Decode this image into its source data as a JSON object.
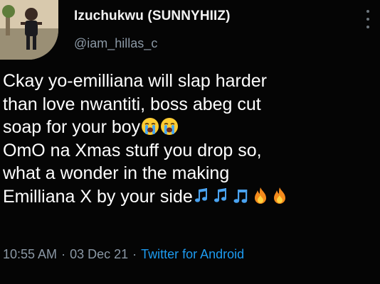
{
  "author": {
    "display_name": "Izuchukwu (SUNNYHIIZ)",
    "handle": "@iam_hillas_c"
  },
  "tweet": {
    "lines": [
      {
        "text": "Ckay yo-emilliana will slap harder",
        "emojis": []
      },
      {
        "text": "than love nwantiti, boss abeg cut",
        "emojis": []
      },
      {
        "text": "soap for your boy",
        "emojis": [
          "loudly-crying-face",
          "loudly-crying-face"
        ]
      },
      {
        "text": "OmO na Xmas stuff you drop so,",
        "emojis": []
      },
      {
        "text": "what a wonder in the making",
        "emojis": []
      },
      {
        "text": "Emilliana X by your side",
        "emojis": [
          "multiple-musical-notes",
          "multiple-musical-notes",
          "musical-note",
          "fire",
          "fire"
        ]
      }
    ]
  },
  "meta": {
    "time": "10:55 AM",
    "date": "03 Dec 21",
    "separator": "·",
    "source": "Twitter for Android"
  },
  "colors": {
    "background": "#050505",
    "text": "#ffffff",
    "secondary": "#8b98a5",
    "link": "#1d9bf0"
  }
}
